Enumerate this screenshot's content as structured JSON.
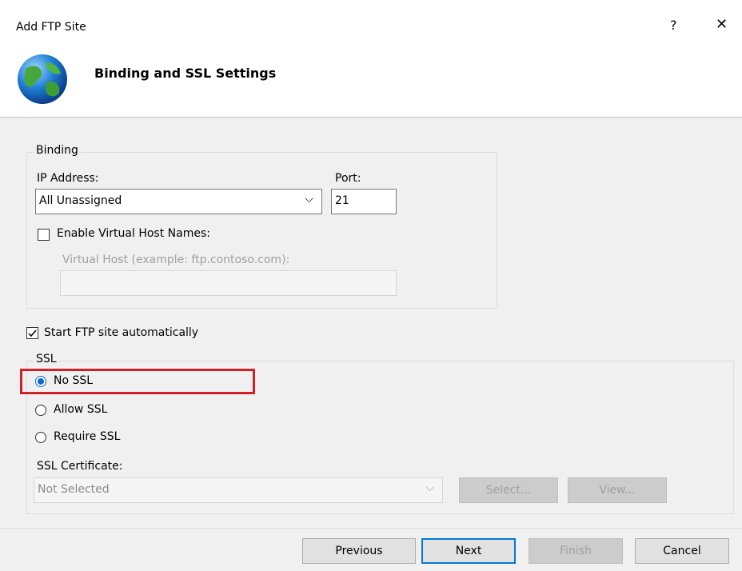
{
  "window": {
    "title": "Add FTP Site",
    "help_glyph": "?",
    "close_glyph": "✕"
  },
  "banner": {
    "heading": "Binding and SSL Settings",
    "icon": "globe-icon"
  },
  "binding": {
    "group_label": "Binding",
    "ip_label": "IP Address:",
    "ip_value": "All Unassigned",
    "port_label": "Port:",
    "port_value": "21",
    "virtual_host_checkbox_label": "Enable Virtual Host Names:",
    "virtual_host_checked": false,
    "virtual_host_label": "Virtual Host (example: ftp.contoso.com):",
    "virtual_host_value": ""
  },
  "start_auto": {
    "label": "Start FTP site automatically",
    "checked": true
  },
  "ssl": {
    "group_label": "SSL",
    "options": [
      {
        "label": "No SSL",
        "selected": true
      },
      {
        "label": "Allow SSL",
        "selected": false
      },
      {
        "label": "Require SSL",
        "selected": false
      }
    ],
    "cert_label": "SSL Certificate:",
    "cert_value": "Not Selected",
    "select_label": "Select...",
    "view_label": "View..."
  },
  "footer": {
    "previous_label": "Previous",
    "next_label": "Next",
    "finish_label": "Finish",
    "cancel_label": "Cancel"
  },
  "colors": {
    "highlight": "#d32027",
    "radio_accent": "#0a6ad2",
    "default_button_border": "#0078d7"
  }
}
